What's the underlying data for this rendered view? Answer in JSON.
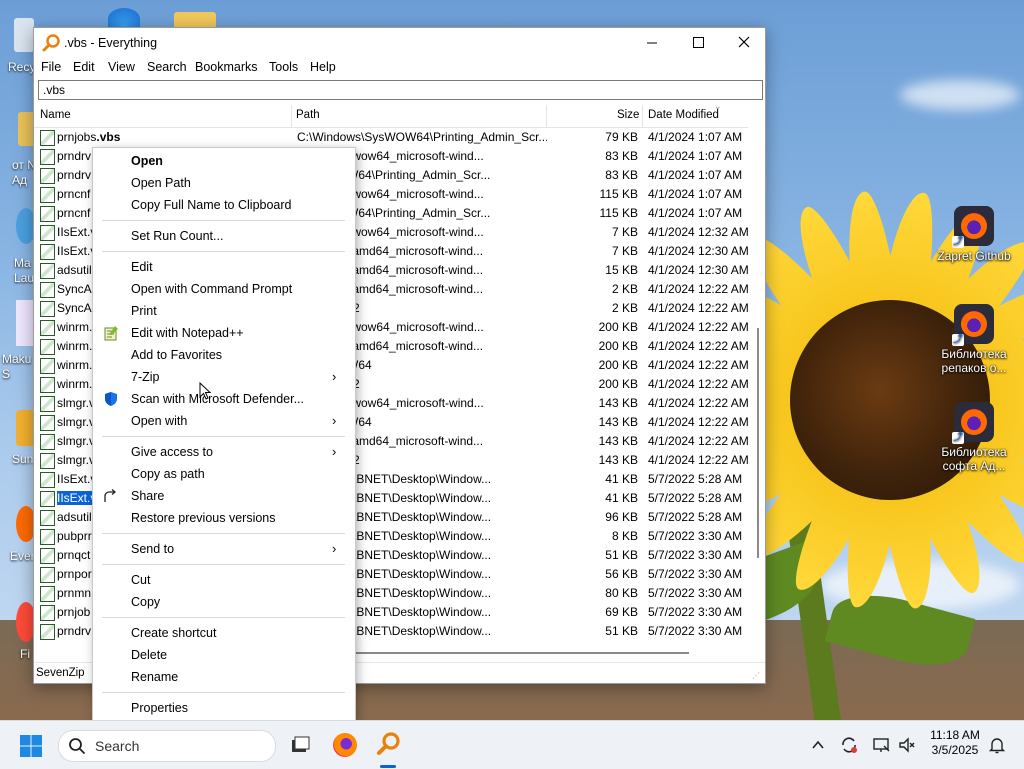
{
  "desktop": {
    "icons": [
      {
        "label": "Zapret Github"
      },
      {
        "label": "Библиотека репаков о..."
      },
      {
        "label": "Библиотека софта Ад..."
      }
    ],
    "partial_left_labels": [
      "Recy",
      "от N\nАд",
      "Ma\nLau",
      "Maku\nS",
      "Sun",
      "Ever",
      "Fi"
    ]
  },
  "window": {
    "title": ".vbs - Everything",
    "menu": [
      "File",
      "Edit",
      "View",
      "Search",
      "Bookmarks",
      "Tools",
      "Help"
    ],
    "search_value": ".vbs",
    "columns": {
      "name": "Name",
      "path": "Path",
      "size": "Size",
      "date": "Date Modified"
    },
    "rows": [
      {
        "name": "prnjobs",
        "ext": ".vbs",
        "path": "C:\\Windows\\SysWOW64\\Printing_Admin_Scr...",
        "size": "79 KB",
        "date": "4/1/2024 1:07 AM"
      },
      {
        "name": "prndrv",
        "ext": "",
        "path": "s\\WinSxS\\wow64_microsoft-wind...",
        "size": "83 KB",
        "date": "4/1/2024 1:07 AM"
      },
      {
        "name": "prndrv",
        "ext": "",
        "path": "s\\SysWOW64\\Printing_Admin_Scr...",
        "size": "83 KB",
        "date": "4/1/2024 1:07 AM"
      },
      {
        "name": "prncnf",
        "ext": "",
        "path": "s\\WinSxS\\wow64_microsoft-wind...",
        "size": "115 KB",
        "date": "4/1/2024 1:07 AM"
      },
      {
        "name": "prncnf",
        "ext": "",
        "path": "s\\SysWOW64\\Printing_Admin_Scr...",
        "size": "115 KB",
        "date": "4/1/2024 1:07 AM"
      },
      {
        "name": "IIsExt.v",
        "ext": "",
        "path": "s\\WinSxS\\wow64_microsoft-wind...",
        "size": "7 KB",
        "date": "4/1/2024 12:32 AM"
      },
      {
        "name": "IIsExt.v",
        "ext": "",
        "path": "s\\WinSxS\\amd64_microsoft-wind...",
        "size": "7 KB",
        "date": "4/1/2024 12:30 AM"
      },
      {
        "name": "adsutil",
        "ext": "",
        "path": "s\\WinSxS\\amd64_microsoft-wind...",
        "size": "15 KB",
        "date": "4/1/2024 12:30 AM"
      },
      {
        "name": "SyncAp",
        "ext": "",
        "path": "s\\WinSxS\\amd64_microsoft-wind...",
        "size": "2 KB",
        "date": "4/1/2024 12:22 AM"
      },
      {
        "name": "SyncAp",
        "ext": "",
        "path": "s\\System32",
        "size": "2 KB",
        "date": "4/1/2024 12:22 AM"
      },
      {
        "name": "winrm.",
        "ext": "",
        "path": "s\\WinSxS\\wow64_microsoft-wind...",
        "size": "200 KB",
        "date": "4/1/2024 12:22 AM"
      },
      {
        "name": "winrm.",
        "ext": "",
        "path": "s\\WinSxS\\amd64_microsoft-wind...",
        "size": "200 KB",
        "date": "4/1/2024 12:22 AM"
      },
      {
        "name": "winrm.",
        "ext": "",
        "path": "s\\SysWOW64",
        "size": "200 KB",
        "date": "4/1/2024 12:22 AM"
      },
      {
        "name": "winrm.",
        "ext": "",
        "path": "s\\System32",
        "size": "200 KB",
        "date": "4/1/2024 12:22 AM"
      },
      {
        "name": "slmgr.v",
        "ext": "",
        "path": "s\\WinSxS\\wow64_microsoft-wind...",
        "size": "143 KB",
        "date": "4/1/2024 12:22 AM"
      },
      {
        "name": "slmgr.v",
        "ext": "",
        "path": "s\\SysWOW64",
        "size": "143 KB",
        "date": "4/1/2024 12:22 AM"
      },
      {
        "name": "slmgr.v",
        "ext": "",
        "path": "s\\WinSxS\\amd64_microsoft-wind...",
        "size": "143 KB",
        "date": "4/1/2024 12:22 AM"
      },
      {
        "name": "slmgr.v",
        "ext": "",
        "path": "s\\System32",
        "size": "143 KB",
        "date": "4/1/2024 12:22 AM"
      },
      {
        "name": "IIsExt.v",
        "ext": "",
        "path": "M6.COLLABNET\\Desktop\\Window...",
        "size": "41 KB",
        "date": "5/7/2022 5:28 AM"
      },
      {
        "name": "IIsExt.v",
        "ext": "",
        "path": "M6.COLLABNET\\Desktop\\Window...",
        "size": "41 KB",
        "date": "5/7/2022 5:28 AM",
        "selected": true
      },
      {
        "name": "adsutil",
        "ext": "",
        "path": "M6.COLLABNET\\Desktop\\Window...",
        "size": "96 KB",
        "date": "5/7/2022 5:28 AM"
      },
      {
        "name": "pubprr",
        "ext": "",
        "path": "M6.COLLABNET\\Desktop\\Window...",
        "size": "8 KB",
        "date": "5/7/2022 3:30 AM"
      },
      {
        "name": "prnqct",
        "ext": "",
        "path": "M6.COLLABNET\\Desktop\\Window...",
        "size": "51 KB",
        "date": "5/7/2022 3:30 AM"
      },
      {
        "name": "prnpor",
        "ext": "",
        "path": "M6.COLLABNET\\Desktop\\Window...",
        "size": "56 KB",
        "date": "5/7/2022 3:30 AM"
      },
      {
        "name": "prnmn",
        "ext": "",
        "path": "M6.COLLABNET\\Desktop\\Window...",
        "size": "80 KB",
        "date": "5/7/2022 3:30 AM"
      },
      {
        "name": "prnjob",
        "ext": "",
        "path": "M6.COLLABNET\\Desktop\\Window...",
        "size": "69 KB",
        "date": "5/7/2022 3:30 AM"
      },
      {
        "name": "prndrv",
        "ext": "",
        "path": "M6.COLLABNET\\Desktop\\Window...",
        "size": "51 KB",
        "date": "5/7/2022 3:30 AM"
      }
    ],
    "status": "SevenZip"
  },
  "context_menu": {
    "items": [
      {
        "label": "Open",
        "bold": true
      },
      {
        "label": "Open Path"
      },
      {
        "label": "Copy Full Name to Clipboard"
      },
      {
        "separator": true
      },
      {
        "label": "Set Run Count..."
      },
      {
        "separator": true
      },
      {
        "label": "Edit"
      },
      {
        "label": "Open with Command Prompt"
      },
      {
        "label": "Print"
      },
      {
        "label": "Edit with Notepad++",
        "icon": "notepad-plus-icon"
      },
      {
        "label": "Add to Favorites"
      },
      {
        "label": "7-Zip",
        "submenu": true,
        "hover": true
      },
      {
        "label": "Scan with Microsoft Defender...",
        "icon": "defender-shield-icon"
      },
      {
        "label": "Open with",
        "submenu": true
      },
      {
        "separator": true
      },
      {
        "label": "Give access to",
        "submenu": true
      },
      {
        "label": "Copy as path"
      },
      {
        "label": "Share",
        "icon": "share-icon"
      },
      {
        "label": "Restore previous versions"
      },
      {
        "separator": true
      },
      {
        "label": "Send to",
        "submenu": true
      },
      {
        "separator": true
      },
      {
        "label": "Cut"
      },
      {
        "label": "Copy"
      },
      {
        "separator": true
      },
      {
        "label": "Create shortcut"
      },
      {
        "label": "Delete"
      },
      {
        "label": "Rename"
      },
      {
        "separator": true
      },
      {
        "label": "Properties"
      }
    ]
  },
  "taskbar": {
    "search_placeholder": "Search",
    "time": "11:18 AM",
    "date": "3/5/2025"
  },
  "colors": {
    "selection": "#0a64d8",
    "app_accent": "#e8820c"
  }
}
